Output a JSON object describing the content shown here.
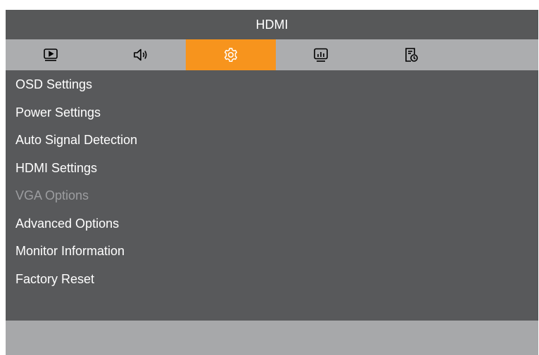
{
  "header": {
    "title": "HDMI"
  },
  "tabs": [
    {
      "icon": "play-icon",
      "active": false
    },
    {
      "icon": "speaker-icon",
      "active": false
    },
    {
      "icon": "gear-icon",
      "active": true
    },
    {
      "icon": "monitor-icon",
      "active": false
    },
    {
      "icon": "document-clock-icon",
      "active": false
    }
  ],
  "menu": {
    "items": [
      {
        "label": "OSD Settings",
        "enabled": true
      },
      {
        "label": "Power Settings",
        "enabled": true
      },
      {
        "label": "Auto Signal Detection",
        "enabled": true
      },
      {
        "label": "HDMI Settings",
        "enabled": true
      },
      {
        "label": "VGA Options",
        "enabled": false
      },
      {
        "label": "Advanced Options",
        "enabled": true
      },
      {
        "label": "Monitor Information",
        "enabled": true
      },
      {
        "label": "Factory Reset",
        "enabled": true
      }
    ]
  },
  "colors": {
    "accent": "#f7941d",
    "menu_background": "#58595b",
    "tab_background": "#acadaf",
    "disabled_text": "#9c9da0"
  }
}
